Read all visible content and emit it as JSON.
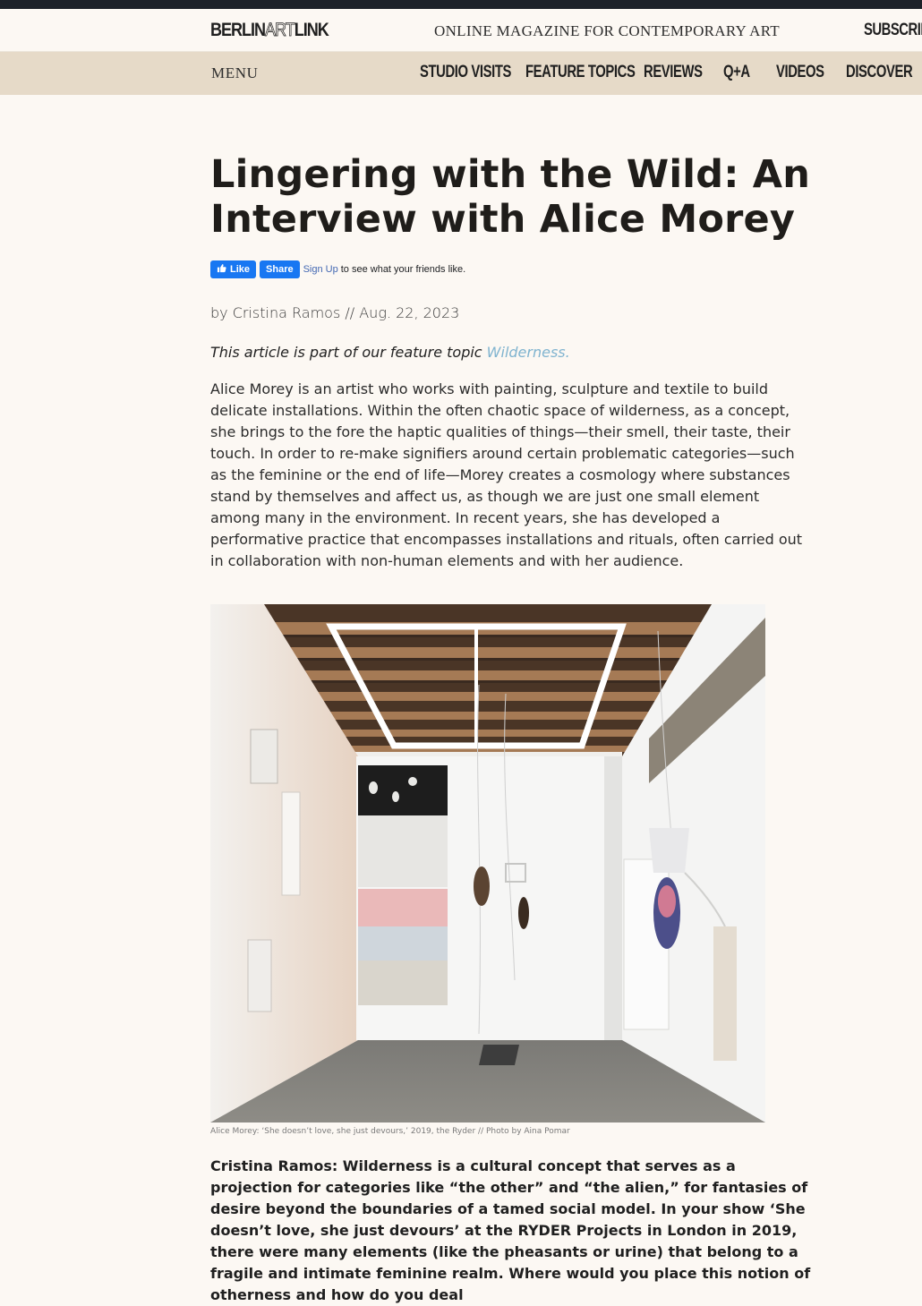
{
  "header": {
    "logo": {
      "left": "BERLIN",
      "mid": "ART",
      "right": "LINK"
    },
    "tagline": "ONLINE MAGAZINE FOR CONTEMPORARY ART",
    "subscribe": "SUBSCRIBE"
  },
  "nav": {
    "menu_label": "MENU",
    "links": [
      "STUDIO VISITS",
      "FEATURE TOPICS",
      "REVIEWS",
      "Q+A",
      "VIDEOS",
      "DISCOVER"
    ]
  },
  "article": {
    "title_line1": "Lingering with the Wild: An",
    "title_line2": "Interview with Alice Morey",
    "facebook": {
      "like": "Like",
      "share": "Share",
      "signup": "Sign Up",
      "rest": "to see what your friends like."
    },
    "byline": "by Cristina Ramos // Aug. 22, 2023",
    "part_of_prefix": "This article is part of our feature topic ",
    "part_of_link": "Wilderness.",
    "intro": "Alice Morey is an artist who works with painting, sculpture and textile to build delicate installations. Within the often chaotic space of wilderness, as a concept, she brings to the fore the haptic qualities of things—their smell, their taste, their touch. In order to re-make signifiers around certain problematic categories—such as the feminine or the end of life—Morey creates a cosmology where substances stand by themselves and affect us, as though we are just one small element among many in the environment. In recent years, she has developed a performative practice that encompasses installations and rituals, often carried out in collaboration with non-human elements and with her audience.",
    "image_caption": "Alice Morey: ‘She doesn’t love, she just devours,’ 2019, the Ryder // Photo by Aina Pomar",
    "question": "Cristina Ramos: Wilderness is a cultural concept that serves as a projection for categories like “the other” and “the alien,” for fantasies of desire beyond the boundaries of a tamed social model. In your show ‘She doesn’t love, she just devours’ at the RYDER Projects in London in 2019, there were many elements (like the pheasants or urine) that belong to a fragile and intimate feminine realm. Where would you place this notion of otherness and how do you deal"
  },
  "colors": {
    "page_bg": "#fcf8f3",
    "top_strip": "#1d2229",
    "nav_bg": "#e6dac8",
    "link_accent": "#7fb3cf",
    "facebook_blue": "#1877f2"
  }
}
